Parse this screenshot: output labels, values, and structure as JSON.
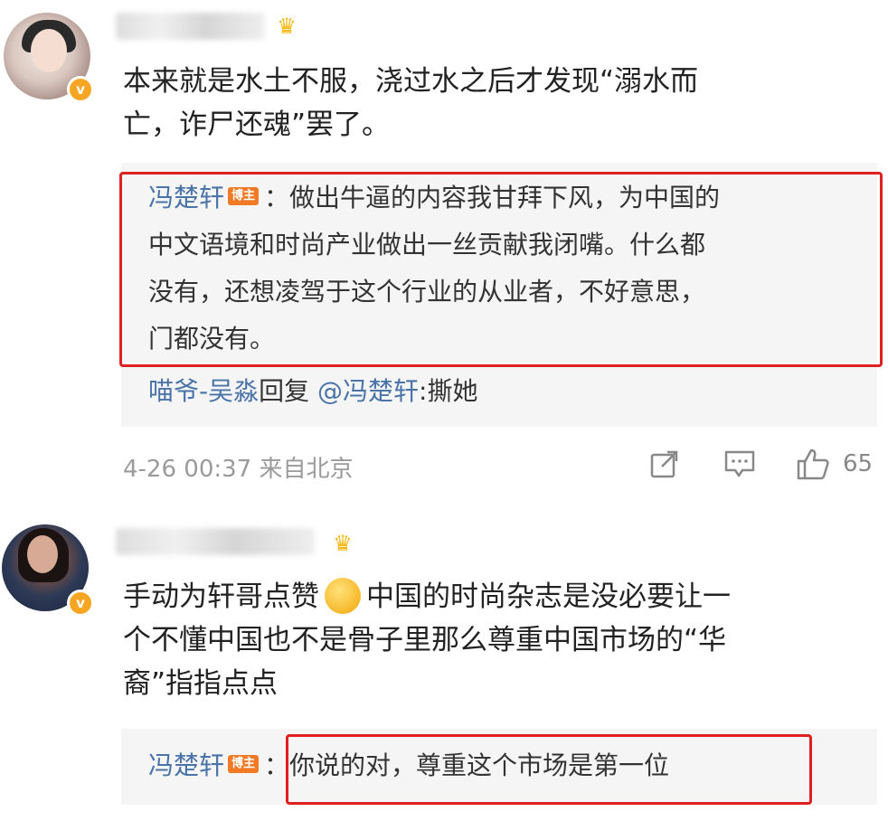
{
  "comments": [
    {
      "body_lines": [
        "本来就是水土不服，浇过水之后才发现“溺水而",
        "亡，诈尸还魂”罢了。"
      ],
      "reply": {
        "author": "冯楚轩",
        "badge": "博主",
        "lines": [
          "：做出牛逼的内容我甘拜下风，为中国的",
          "中文语境和时尚产业做出一丝贡献我闭嘴。什么都",
          "没有，还想凌驾于这个行业的从业者，不好意思，",
          "门都没有。"
        ]
      },
      "sub_reply": {
        "author": "喵爷-吴淼",
        "verb": "回复",
        "mention": "@冯楚轩",
        "text": ":撕她"
      },
      "timestamp": "4-26 00:37 来自北京",
      "likes": "65"
    },
    {
      "body_lines": [
        "手动为轩哥点赞",
        "中国的时尚杂志是没必要让一",
        "个不懂中国也不是骨子里那么尊重中国市场的“华",
        "裔”指指点点"
      ],
      "reply": {
        "author": "冯楚轩",
        "badge": "博主",
        "text": "：你说的对，尊重这个市场是第一位"
      }
    }
  ],
  "icons": {
    "share": "share-icon",
    "comment": "comment-icon",
    "like": "thumbs-up-icon"
  },
  "colors": {
    "highlight_border": "#e02020",
    "author_link": "#4a74a8",
    "host_badge": "#f07a26",
    "verified_badge": "#f6a623"
  }
}
